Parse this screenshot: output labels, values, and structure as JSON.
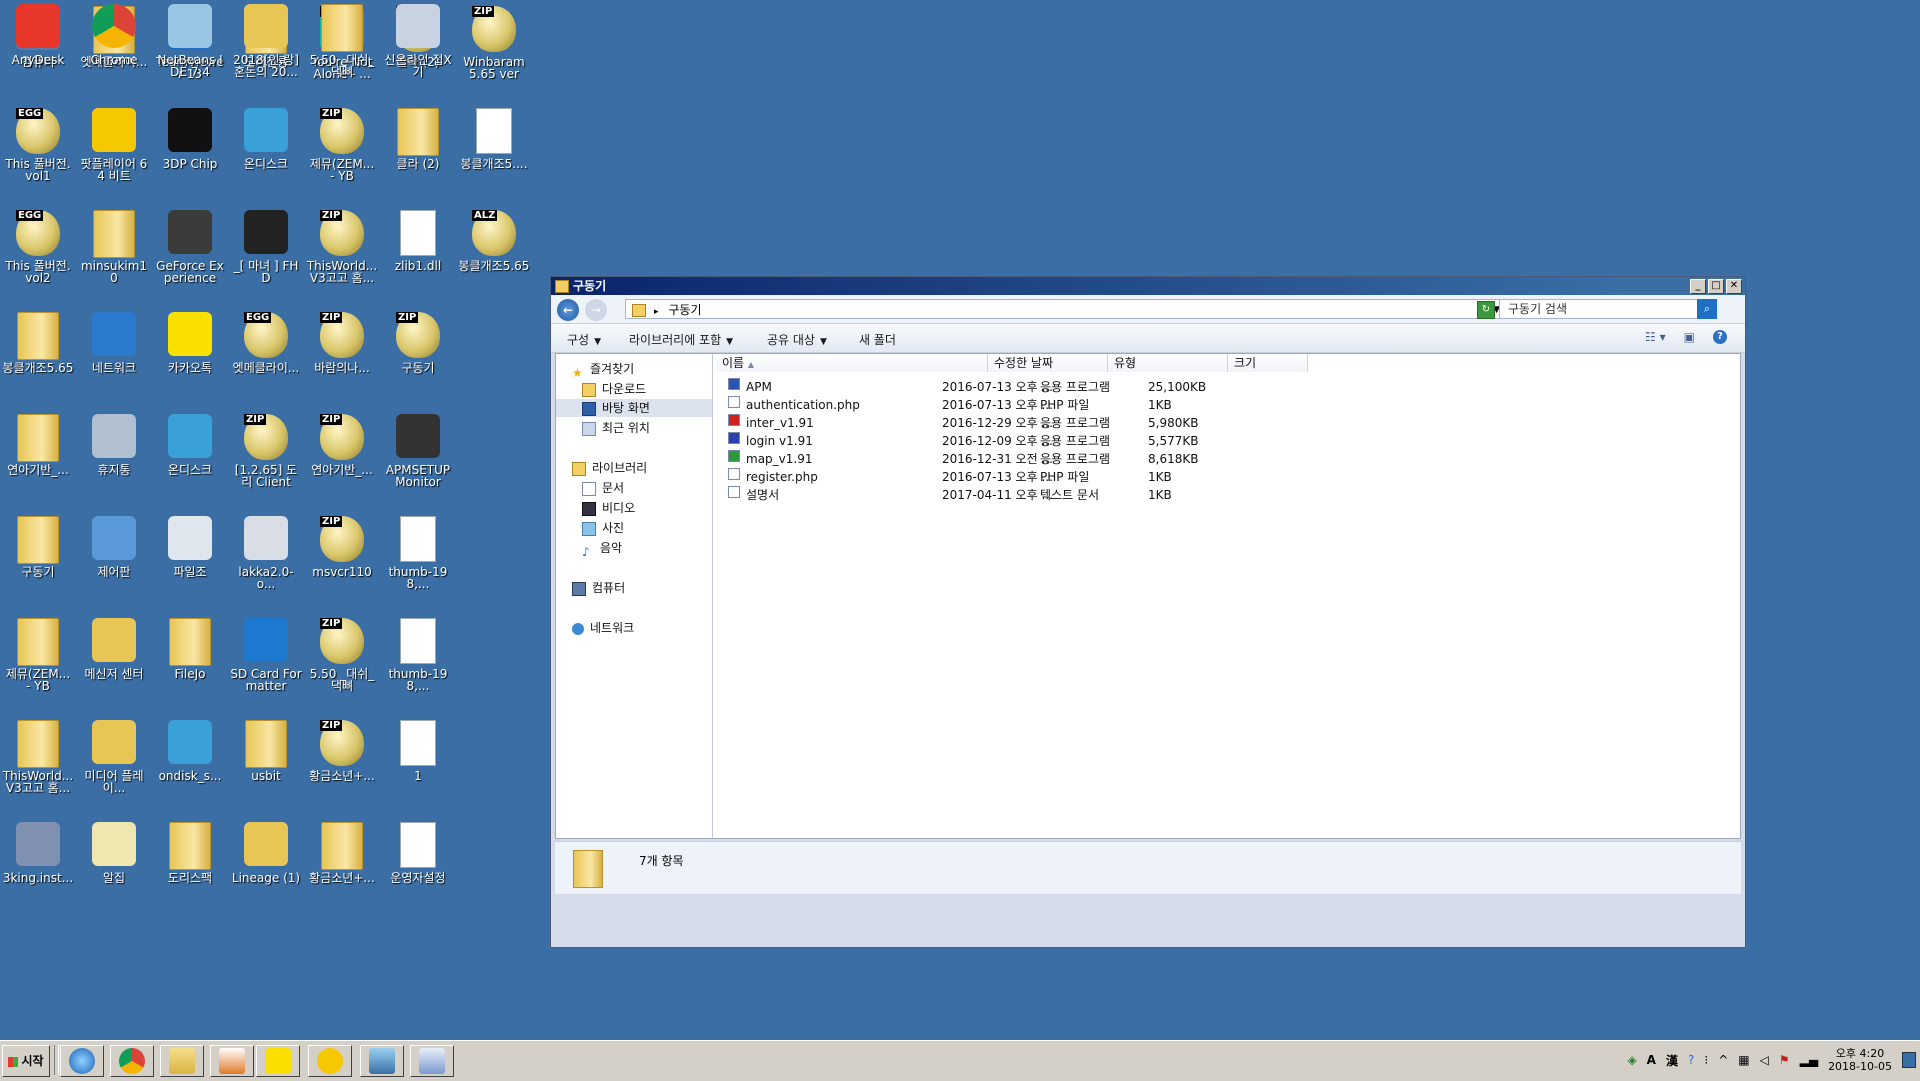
{
  "desktop": {
    "icons": [
      {
        "label": "컴퓨터",
        "kind": "computer",
        "tag": ""
      },
      {
        "label": "엣메클라이...",
        "kind": "folder",
        "tag": ""
      },
      {
        "label": "TeamViewer 13",
        "kind": "teamviewer",
        "tag": ""
      },
      {
        "label": "도리진룡",
        "kind": "folder",
        "tag": ""
      },
      {
        "label": "You're Not Alone - ...",
        "kind": "mp3",
        "tag": "MP3"
      },
      {
        "label": "클라 (2)",
        "kind": "egg",
        "tag": "ZIP"
      },
      {
        "label": "Winbaram 5.65 ver",
        "kind": "egg",
        "tag": "ZIP"
      },
      {
        "label": "This 풀버전.vol1",
        "kind": "egg",
        "tag": "EGG"
      },
      {
        "label": "팟플레이어 64 비트",
        "kind": "potplayer",
        "tag": ""
      },
      {
        "label": "3DP Chip",
        "kind": "3dp",
        "tag": ""
      },
      {
        "label": "온디스크",
        "kind": "ondisk",
        "tag": ""
      },
      {
        "label": "제뮤(ZEM... - YB",
        "kind": "egg",
        "tag": "ZIP"
      },
      {
        "label": "클라 (2)",
        "kind": "folder",
        "tag": ""
      },
      {
        "label": "봉클개조5....",
        "kind": "file",
        "tag": ""
      },
      {
        "label": "This 풀버전.vol2",
        "kind": "egg",
        "tag": "EGG"
      },
      {
        "label": "minsukim10",
        "kind": "folder",
        "tag": ""
      },
      {
        "label": "GeForce Experience",
        "kind": "geforce",
        "tag": ""
      },
      {
        "label": "_[ 마녀 ] FHD",
        "kind": "video",
        "tag": ""
      },
      {
        "label": "ThisWorld... V3고고 홈...",
        "kind": "egg",
        "tag": "ZIP"
      },
      {
        "label": "zlib1.dll",
        "kind": "dll",
        "tag": ""
      },
      {
        "label": "봉클개조5.65",
        "kind": "egg",
        "tag": "ALZ"
      },
      {
        "label": "봉클개조5.65",
        "kind": "folder",
        "tag": ""
      },
      {
        "label": "네트워크",
        "kind": "network",
        "tag": ""
      },
      {
        "label": "카카오톡",
        "kind": "kakao",
        "tag": ""
      },
      {
        "label": "엣메클라이...",
        "kind": "egg",
        "tag": "EGG"
      },
      {
        "label": "바람의나...",
        "kind": "egg",
        "tag": "ZIP"
      },
      {
        "label": "구동기",
        "kind": "egg",
        "tag": "ZIP"
      },
      {
        "label": "",
        "kind": "none",
        "tag": ""
      },
      {
        "label": "연아기반_...",
        "kind": "folder",
        "tag": ""
      },
      {
        "label": "휴지통",
        "kind": "recycle",
        "tag": ""
      },
      {
        "label": "온디스크",
        "kind": "ondisk",
        "tag": ""
      },
      {
        "label": "[1.2.65] 도리 Client",
        "kind": "egg",
        "tag": "ZIP"
      },
      {
        "label": "연아기반_...",
        "kind": "egg",
        "tag": "ZIP"
      },
      {
        "label": "APMSETUP Monitor",
        "kind": "apm",
        "tag": ""
      },
      {
        "label": "",
        "kind": "none",
        "tag": ""
      },
      {
        "label": "구동기",
        "kind": "folder",
        "tag": ""
      },
      {
        "label": "제어판",
        "kind": "control",
        "tag": ""
      },
      {
        "label": "파일조",
        "kind": "filejo",
        "tag": ""
      },
      {
        "label": "lakka2.0-o...",
        "kind": "cd",
        "tag": ""
      },
      {
        "label": "msvcr110",
        "kind": "egg",
        "tag": "ZIP"
      },
      {
        "label": "thumb-198,...",
        "kind": "thumb",
        "tag": ""
      },
      {
        "label": "",
        "kind": "none",
        "tag": ""
      },
      {
        "label": "제뮤(ZEM... - YB",
        "kind": "folder",
        "tag": ""
      },
      {
        "label": "메신저 센터",
        "kind": "messenger",
        "tag": ""
      },
      {
        "label": "FileJo",
        "kind": "folder",
        "tag": ""
      },
      {
        "label": "SD Card Formatter",
        "kind": "sd",
        "tag": ""
      },
      {
        "label": "5.50 _대쉬_댁뼈",
        "kind": "egg",
        "tag": "ZIP"
      },
      {
        "label": "thumb-198,...",
        "kind": "thumb",
        "tag": ""
      },
      {
        "label": "",
        "kind": "none",
        "tag": ""
      },
      {
        "label": "ThisWorld... V3고고 홈...",
        "kind": "folder",
        "tag": ""
      },
      {
        "label": "미디어 플레이...",
        "kind": "media",
        "tag": ""
      },
      {
        "label": "ondisk_s...",
        "kind": "ondisk",
        "tag": ""
      },
      {
        "label": "usbit",
        "kind": "folder",
        "tag": ""
      },
      {
        "label": "황금소년+...",
        "kind": "egg",
        "tag": "ZIP"
      },
      {
        "label": "1",
        "kind": "file",
        "tag": ""
      },
      {
        "label": "",
        "kind": "none",
        "tag": ""
      },
      {
        "label": "3king.inst...",
        "kind": "installer",
        "tag": ""
      },
      {
        "label": "알집",
        "kind": "alzip",
        "tag": ""
      },
      {
        "label": "도리스팩",
        "kind": "folder",
        "tag": ""
      },
      {
        "label": "Lineage (1)",
        "kind": "lineage",
        "tag": ""
      },
      {
        "label": "황금소년+...",
        "kind": "folder",
        "tag": ""
      },
      {
        "label": "운영자설정",
        "kind": "file",
        "tag": ""
      },
      {
        "label": "",
        "kind": "none",
        "tag": ""
      },
      {
        "label": "AnyDesk",
        "kind": "anydesk",
        "tag": ""
      },
      {
        "label": "Chrome",
        "kind": "chrome",
        "tag": ""
      },
      {
        "label": "NetBeans IDE 7.4",
        "kind": "netbeans",
        "tag": ""
      },
      {
        "label": "2018[인.랑] 혼돈의 20...",
        "kind": "mediafolder",
        "tag": ""
      },
      {
        "label": "5.50 _대쉬_댁뼈",
        "kind": "folder",
        "tag": ""
      },
      {
        "label": "신온라인 접X기",
        "kind": "settings",
        "tag": ""
      },
      {
        "label": "",
        "kind": "none",
        "tag": ""
      }
    ]
  },
  "window": {
    "title": "구동기",
    "address_path": "구동기",
    "search_placeholder": "구동기 검색",
    "toolbar": {
      "organize": "구성",
      "include_library": "라이브러리에 포함",
      "share_with": "공유 대상",
      "new_folder": "새 폴더"
    },
    "nav": {
      "favorites": "즐겨찾기",
      "downloads": "다운로드",
      "desktop": "바탕 화면",
      "recent": "최근 위치",
      "libraries": "라이브러리",
      "documents": "문서",
      "videos": "비디오",
      "pictures": "사진",
      "music": "음악",
      "computer": "컴퓨터",
      "network": "네트워크"
    },
    "columns": {
      "name": "이름",
      "modified": "수정한 날짜",
      "type": "유형",
      "size": "크기"
    },
    "files": [
      {
        "name": "APM",
        "modified": "2016-07-13 오후 ...",
        "type": "응용 프로그램",
        "size": "25,100KB",
        "icon": "apm-icon",
        "color": "#2a55b0"
      },
      {
        "name": "authentication.php",
        "modified": "2016-07-13 오후 ...",
        "type": "PHP 파일",
        "size": "1KB",
        "icon": "php-file-icon",
        "color": "#ffffff"
      },
      {
        "name": "inter_v1.91",
        "modified": "2016-12-29 오후 ...",
        "type": "응용 프로그램",
        "size": "5,980KB",
        "icon": "inter-app-icon",
        "color": "#d02020"
      },
      {
        "name": "login v1.91",
        "modified": "2016-12-09 오후 ...",
        "type": "응용 프로그램",
        "size": "5,577KB",
        "icon": "login-app-icon",
        "color": "#2a3fb0"
      },
      {
        "name": "map_v1.91",
        "modified": "2016-12-31 오전 ...",
        "type": "응용 프로그램",
        "size": "8,618KB",
        "icon": "map-app-icon",
        "color": "#2a9a3a"
      },
      {
        "name": "register.php",
        "modified": "2016-07-13 오후 ...",
        "type": "PHP 파일",
        "size": "1KB",
        "icon": "php-file-icon",
        "color": "#ffffff"
      },
      {
        "name": "설명서",
        "modified": "2017-04-11 오후 ...",
        "type": "텍스트 문서",
        "size": "1KB",
        "icon": "text-file-icon",
        "color": "#ffffff"
      }
    ],
    "status": "7개 항목"
  },
  "taskbar": {
    "start_label": "시작",
    "clock_time": "오후 4:20",
    "clock_date": "2018-10-05",
    "ime_a": "A",
    "ime_han": "漢"
  },
  "colors": {
    "desktop_bg": "#3a6ea5",
    "title_bar": "#0a246a",
    "selection": "#dce3ee"
  }
}
